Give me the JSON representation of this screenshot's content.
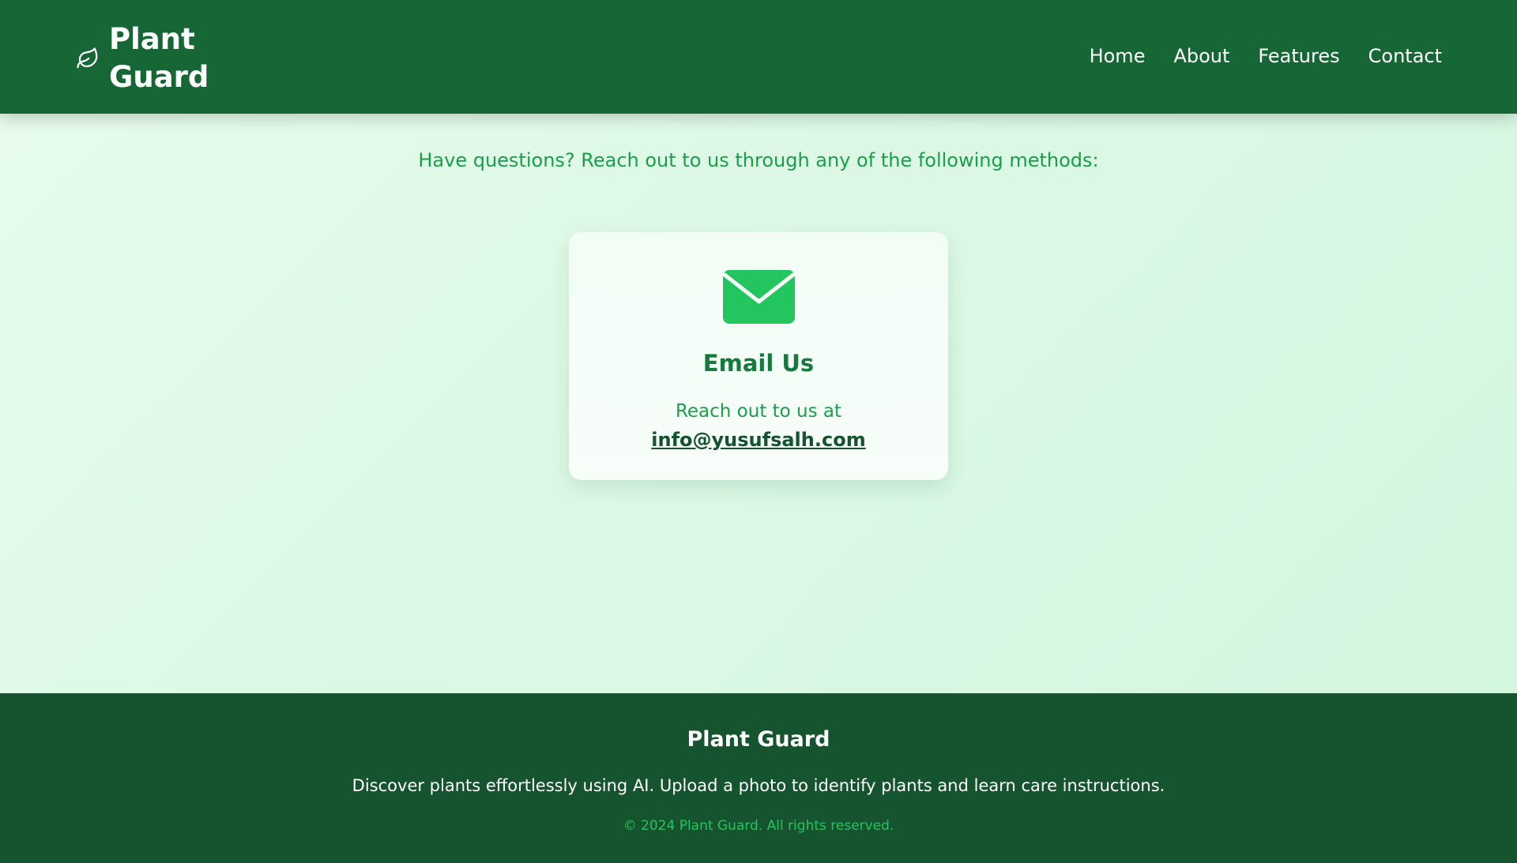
{
  "header": {
    "brand_icon": "leaf-icon",
    "brand_name": "Plant Guard",
    "nav": [
      {
        "label": "Home"
      },
      {
        "label": "About"
      },
      {
        "label": "Features"
      },
      {
        "label": "Contact"
      }
    ]
  },
  "main": {
    "intro": "Have questions? Reach out to us through any of the following methods:",
    "card": {
      "icon": "envelope-icon",
      "title": "Email Us",
      "text": "Reach out to us at",
      "email": "info@yusufsalh.com"
    }
  },
  "footer": {
    "title": "Plant Guard",
    "description": "Discover plants effortlessly using AI. Upload a photo to identify plants and learn care instructions.",
    "copyright": "© 2024 Plant Guard. All rights reserved."
  },
  "colors": {
    "header_bg": "#176736",
    "footer_bg": "#16532f",
    "accent_green": "#22c55e",
    "text_green": "#17a04a"
  }
}
